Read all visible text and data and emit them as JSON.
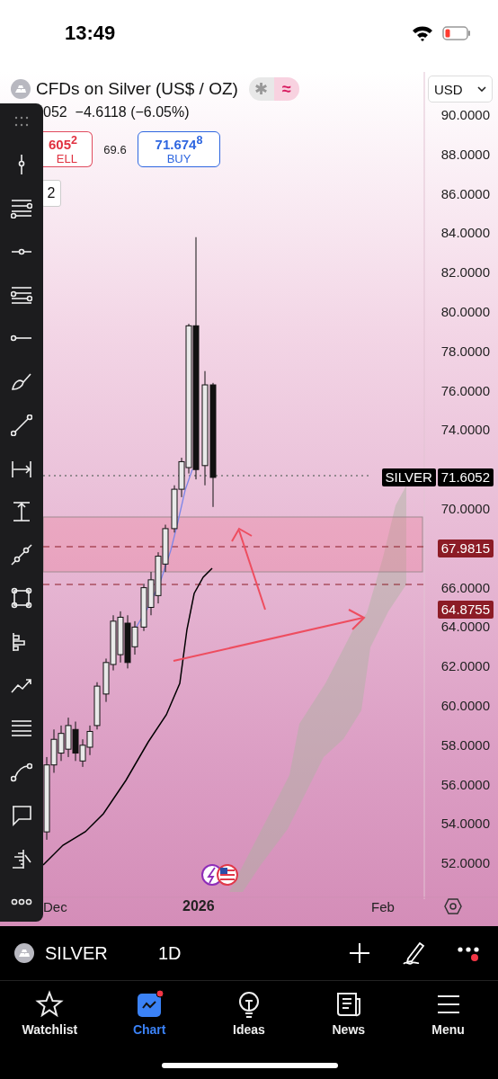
{
  "status_bar": {
    "time": "13:49"
  },
  "header": {
    "title": "CFDs on Silver (US$ / OZ)",
    "currency": "USD",
    "change": "052  −4.6118 (−6.05%)"
  },
  "modes": [
    {
      "symbol": "✱",
      "selected": false
    },
    {
      "symbol": "≈",
      "selected": true
    }
  ],
  "trade": {
    "sell_price": "605$^{2}$",
    "sell_label": "ELL",
    "spread": "69.6",
    "buy_price": "71.674$^{8}$",
    "buy_label": "BUY"
  },
  "indicator_badge": "2",
  "price_axis": [
    "90.0000",
    "88.0000",
    "86.0000",
    "84.0000",
    "82.0000",
    "80.0000",
    "78.0000",
    "76.0000",
    "74.0000",
    "70.0000",
    "66.0000",
    "64.0000",
    "62.0000",
    "60.0000",
    "58.0000",
    "56.0000",
    "54.0000",
    "52.0000"
  ],
  "price_tags": [
    {
      "kind": "last",
      "label": "SILVER",
      "value": "71.6052"
    },
    {
      "kind": "level",
      "value": "67.9815"
    },
    {
      "kind": "level",
      "value": "64.8755"
    }
  ],
  "time_axis": [
    {
      "text": "Dec",
      "bold": false
    },
    {
      "text": "2026",
      "bold": true
    },
    {
      "text": "Feb",
      "bold": false
    }
  ],
  "symbol_bar": {
    "symbol": "SILVER",
    "interval": "1D",
    "more_badge": true
  },
  "tabs": [
    {
      "label": "Watchlist",
      "selected": false,
      "badge": false
    },
    {
      "label": "Chart",
      "selected": true,
      "badge": true
    },
    {
      "label": "Ideas",
      "selected": false,
      "badge": false
    },
    {
      "label": "News",
      "selected": false,
      "badge": false
    },
    {
      "label": "Menu",
      "selected": false,
      "badge": false
    }
  ]
}
